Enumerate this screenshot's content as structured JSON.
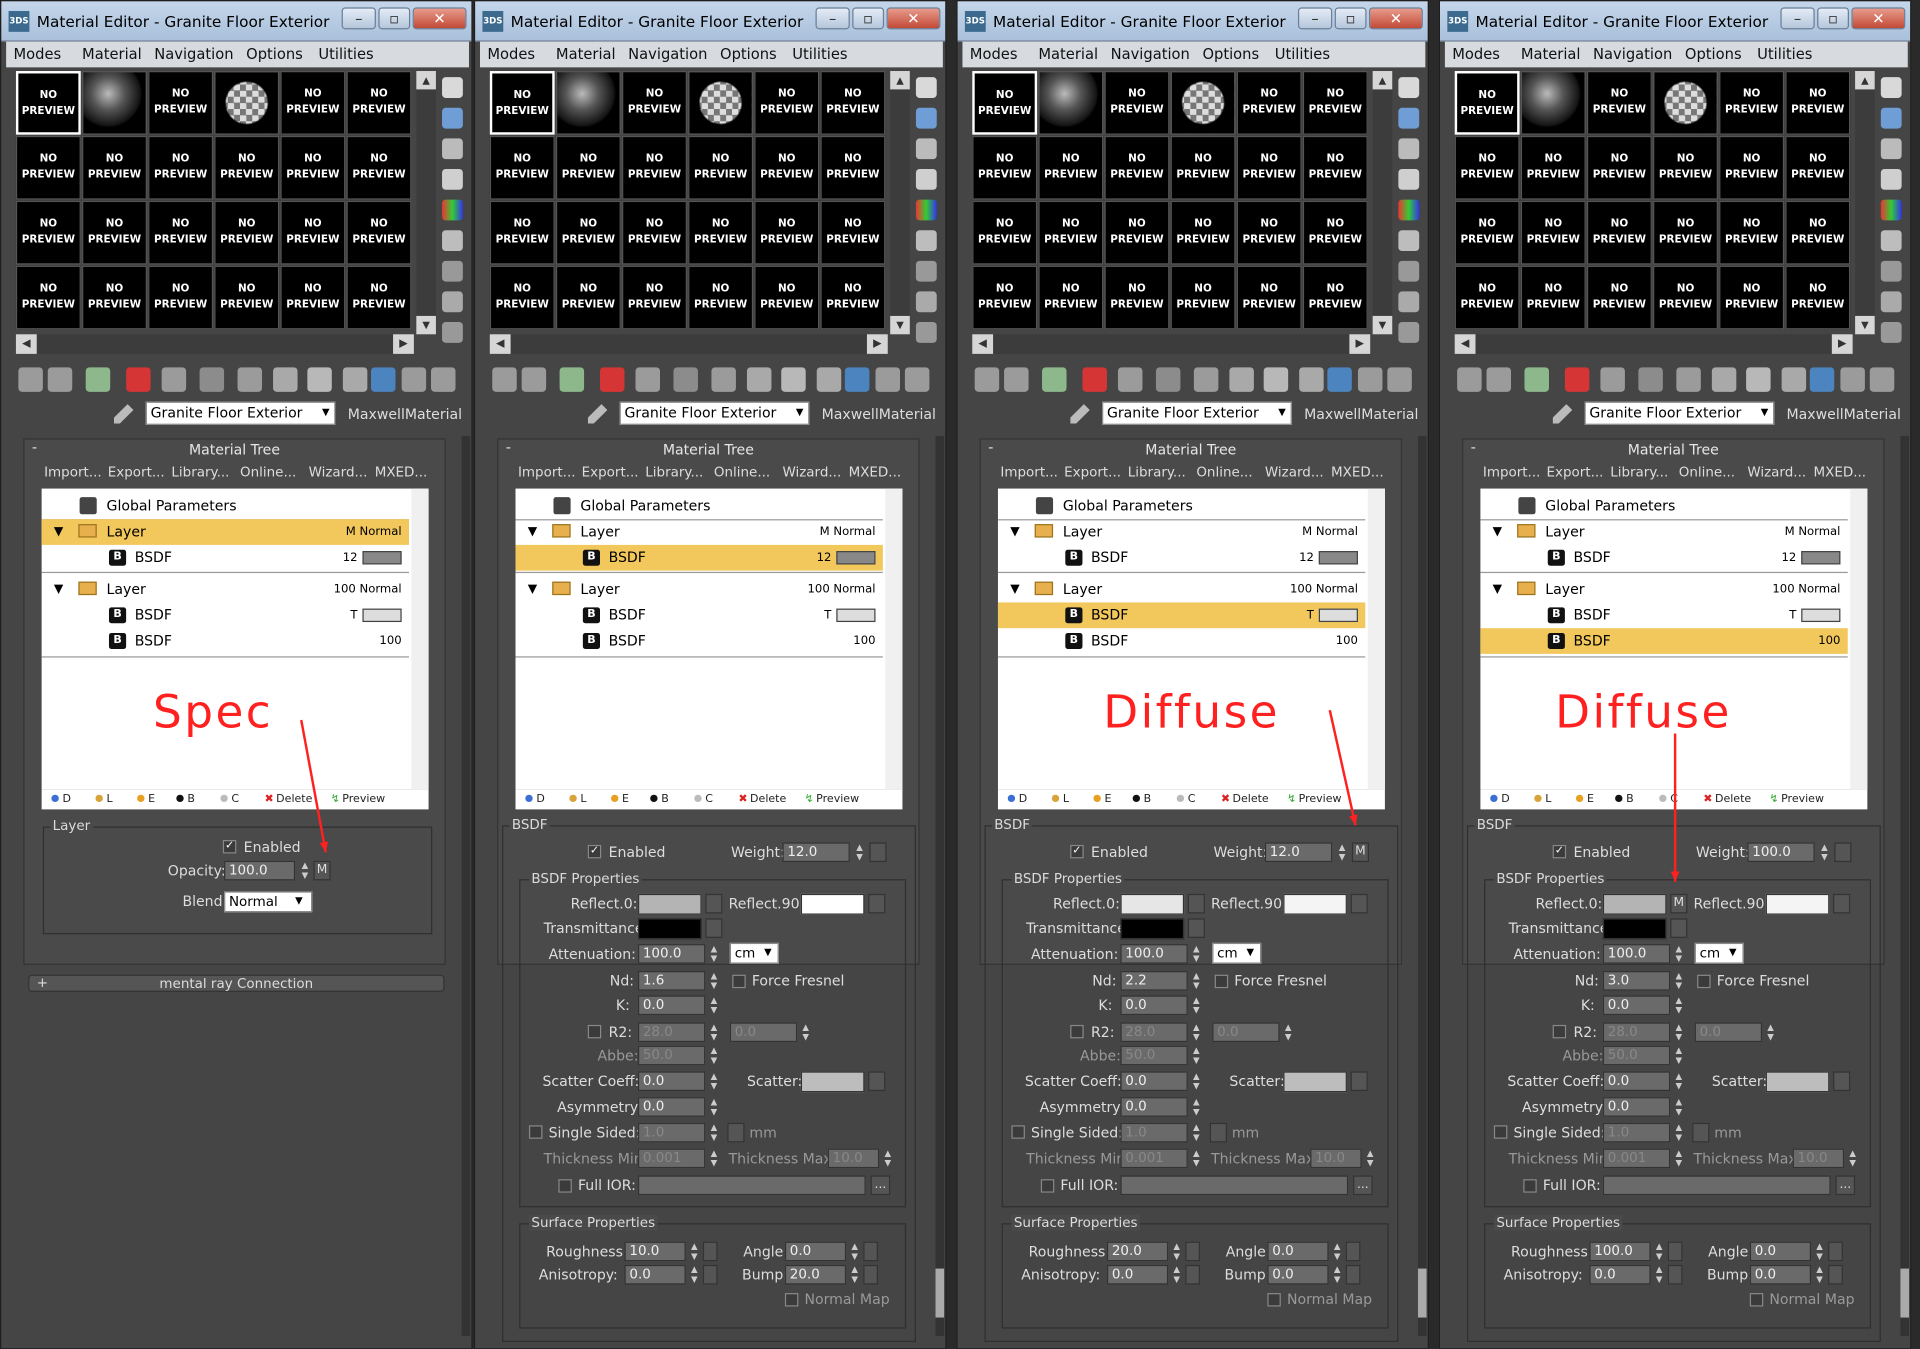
{
  "window_title": "Material Editor - Granite Floor Exterior",
  "app_icon_label": "3DS",
  "menu": [
    "Modes",
    "Material",
    "Navigation",
    "Options",
    "Utilities"
  ],
  "no_preview_label": [
    "NO",
    "PREVIEW"
  ],
  "material_name": "Granite Floor Exterior",
  "material_type": "MaxwellMaterial",
  "material_tree_title": "Material Tree",
  "tree_toolbar": [
    "Import...",
    "Export...",
    "Library...",
    "Online...",
    "Wizard...",
    "MXED..."
  ],
  "tree_rows": {
    "global": "Global Parameters",
    "layer": "Layer",
    "bsdf": "BSDF",
    "layer1_right": "M Normal",
    "layer2_right": "100 Normal",
    "bsdf1_value": "12",
    "bsdf2_value": "T",
    "bsdf3_value": "100"
  },
  "legend": [
    "D",
    "L",
    "E",
    "B",
    "C",
    "Delete",
    "Preview"
  ],
  "colors": {
    "highlight": "#f2c75c",
    "annotation": "#ff2020",
    "panel": "#454545"
  },
  "windows": [
    {
      "selected_row": "layer",
      "annotation": "Spec",
      "panel": "layer"
    },
    {
      "selected_row": "bsdf1",
      "annotation": "",
      "panel": "bsdf"
    },
    {
      "selected_row": "bsdf2",
      "annotation": "Diffuse",
      "panel": "bsdf"
    },
    {
      "selected_row": "bsdf3",
      "annotation": "Diffuse",
      "panel": "bsdf"
    }
  ],
  "layer_panel": {
    "group_label": "Layer",
    "enabled_label": "Enabled",
    "opacity_label": "Opacity:",
    "opacity_value": "100.0",
    "m_label": "M",
    "blend_label": "Blend:",
    "blend_value": "Normal",
    "mental_ray": "mental ray Connection"
  },
  "bsdf_labels": {
    "group": "BSDF",
    "enabled": "Enabled",
    "weight": "Weight:",
    "props_group": "BSDF Properties",
    "reflect0": "Reflect.0:",
    "reflect90": "Reflect.90:",
    "transmittance": "Transmittance:",
    "attenuation": "Attenuation:",
    "attenuation_unit": "cm",
    "nd": "Nd:",
    "force_fresnel": "Force Fresnel",
    "k": "K:",
    "r2": "R2:",
    "abbe": "Abbe:",
    "scatter_coeff": "Scatter Coeff:",
    "scatter": "Scatter:",
    "asymmetry": "Asymmetry:",
    "single_sided": "Single Sided:",
    "mm": "mm",
    "thickness_min": "Thickness Min:",
    "thickness_max": "Thickness Max:",
    "full_ior": "Full IOR:",
    "ellipsis": "...",
    "surface_group": "Surface Properties",
    "roughness": "Roughness:",
    "angle": "Angle:",
    "anisotropy": "Anisotropy:",
    "bump": "Bump:",
    "normal_map": "Normal Map"
  },
  "bsdf_values": [
    null,
    {
      "weight": "12.0",
      "attenuation": "100.0",
      "nd": "1.6",
      "k": "0.0",
      "r2": "28.0",
      "r2b": "0.0",
      "abbe": "50.0",
      "scatter_coeff": "0.0",
      "asymmetry": "0.0",
      "single_sided": "1.0",
      "thickness_min": "0.001",
      "thickness_max": "10.0",
      "roughness": "10.0",
      "angle": "0.0",
      "anisotropy": "0.0",
      "bump": "20.0",
      "reflect0_color": "#b4b4b4",
      "reflect90_color": "#ffffff",
      "scatter_color": "#bdbdbd"
    },
    {
      "weight": "12.0",
      "attenuation": "100.0",
      "nd": "2.2",
      "k": "0.0",
      "r2": "28.0",
      "r2b": "0.0",
      "abbe": "50.0",
      "scatter_coeff": "0.0",
      "asymmetry": "0.0",
      "single_sided": "1.0",
      "thickness_min": "0.001",
      "thickness_max": "10.0",
      "roughness": "20.0",
      "angle": "0.0",
      "anisotropy": "0.0",
      "bump": "0.0",
      "reflect0_color": "#e6e6e6",
      "reflect90_color": "#f4f4f4",
      "scatter_color": "#bdbdbd"
    },
    {
      "weight": "100.0",
      "attenuation": "100.0",
      "nd": "3.0",
      "k": "0.0",
      "r2": "28.0",
      "r2b": "0.0",
      "abbe": "50.0",
      "scatter_coeff": "0.0",
      "asymmetry": "0.0",
      "single_sided": "1.0",
      "thickness_min": "0.001",
      "thickness_max": "10.0",
      "roughness": "100.0",
      "angle": "0.0",
      "anisotropy": "0.0",
      "bump": "0.0",
      "reflect0_color": "#b4b4b4",
      "reflect90_color": "#f4f4f4",
      "scatter_color": "#bdbdbd"
    }
  ]
}
